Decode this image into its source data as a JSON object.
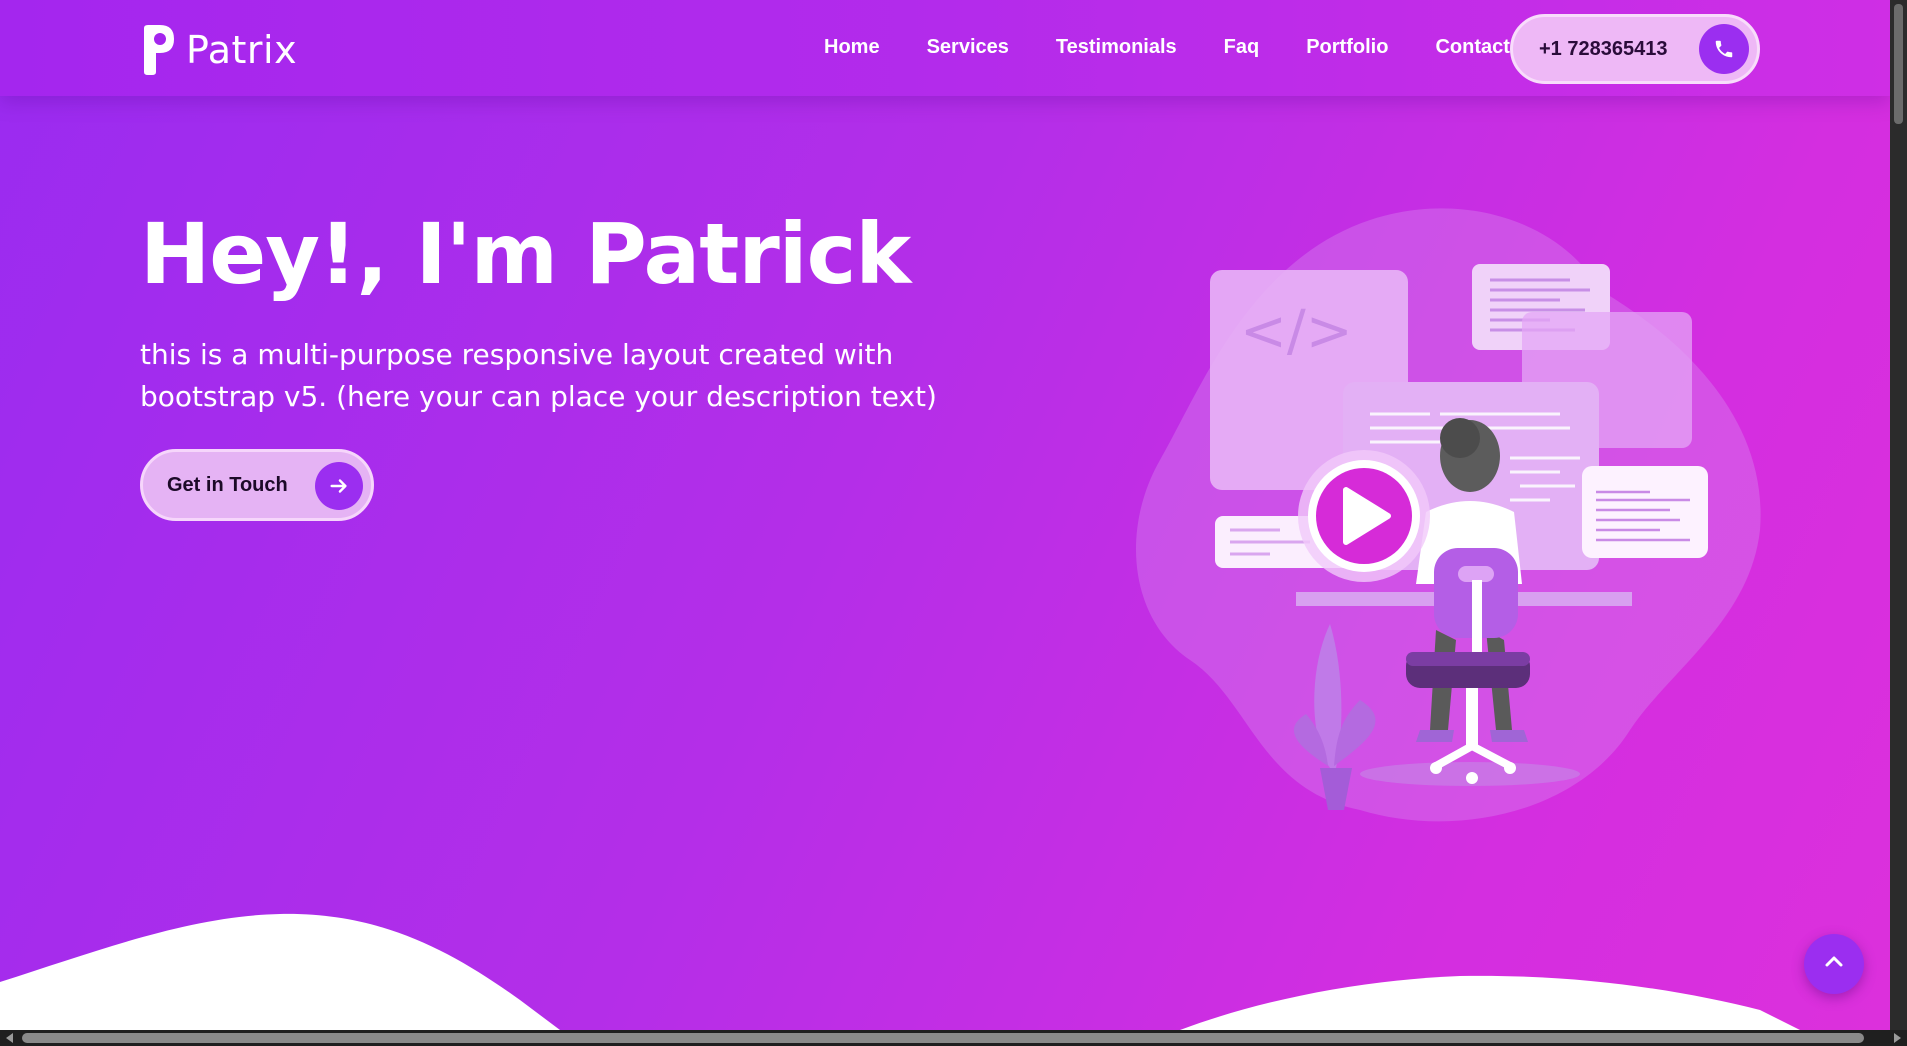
{
  "brand": {
    "name": "Patrix"
  },
  "nav": {
    "items": [
      {
        "label": "Home"
      },
      {
        "label": "Services"
      },
      {
        "label": "Testimonials"
      },
      {
        "label": "Faq"
      },
      {
        "label": "Portfolio"
      },
      {
        "label": "Contact"
      }
    ],
    "phone": "+1 728365413"
  },
  "hero": {
    "title": "Hey!, I'm Patrick",
    "description": "this is a multi-purpose responsive layout created with bootstrap v5. (here your can place your description text)",
    "cta_label": "Get in Touch"
  },
  "icons": {
    "phone": "phone-icon",
    "arrow": "arrow-right-icon",
    "scroll_top": "chevron-up-icon",
    "play": "play-icon"
  },
  "colors": {
    "accent": "#9b2ef0",
    "gradient_start": "#9a2bf0",
    "gradient_end": "#dc30dc",
    "pill_bg": "#eeb8f6"
  }
}
